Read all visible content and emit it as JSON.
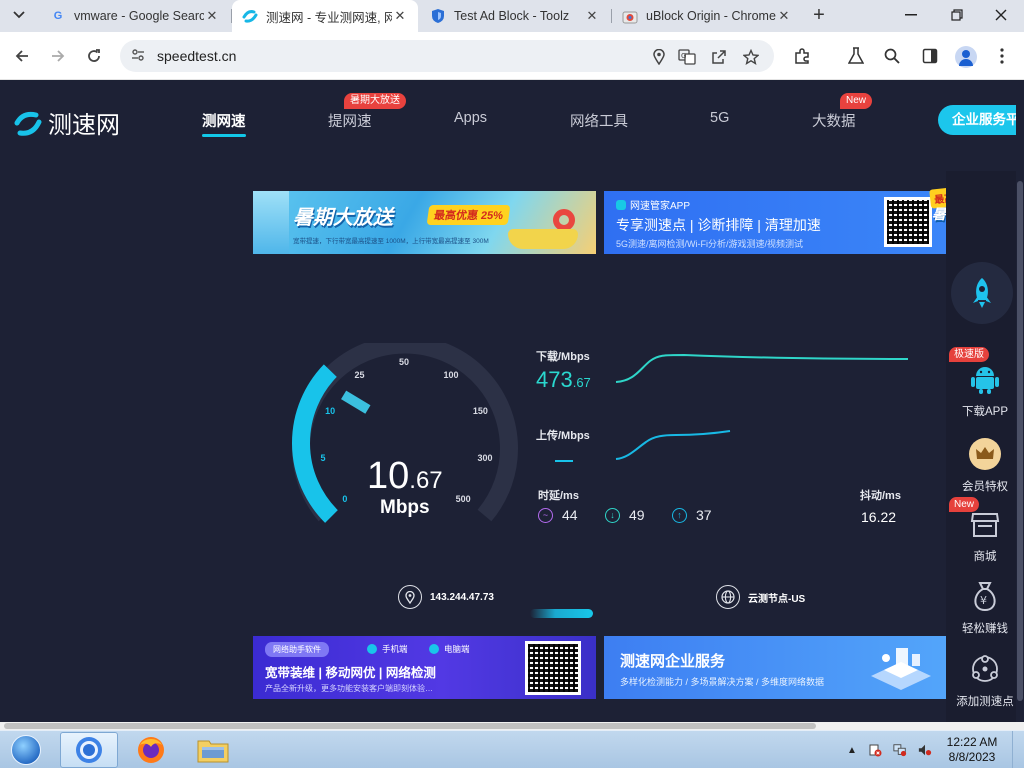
{
  "browser": {
    "tabs": [
      {
        "title": "vmware - Google Searc",
        "favicon": "google-icon"
      },
      {
        "title": "测速网 - 专业测网速, 网",
        "favicon": "speedtest-icon",
        "active": true
      },
      {
        "title": "Test Ad Block - Toolz",
        "favicon": "shield-icon"
      },
      {
        "title": "uBlock Origin - Chrome",
        "favicon": "chrome-web-store-icon"
      }
    ],
    "url": "speedtest.cn"
  },
  "site": {
    "logo_text": "测速网",
    "nav": [
      {
        "label": "测网速",
        "active": true
      },
      {
        "label": "提网速",
        "badge": "暑期大放送"
      },
      {
        "label": "Apps"
      },
      {
        "label": "网络工具"
      },
      {
        "label": "5G"
      },
      {
        "label": "大数据",
        "badge": "New"
      }
    ],
    "enterprise_button": "企业服务平"
  },
  "banners": {
    "summer": {
      "headline": "暑期大放送",
      "pill": "最高优惠 25%",
      "sub": "宽带提速，下行带宽最高提速至 1000M，上行带宽最高提速至 300M"
    },
    "app": {
      "app_name": "网速管家APP",
      "services": "专享测速点 | 诊断排障 | 清理加速",
      "features": "5G测速/离网检测/Wi-Fi分析/游戏测速/视频测试"
    },
    "summer_badge": {
      "pill": "最高优惠 25%",
      "headline": "暑期大放送"
    },
    "tool": {
      "tag": "网络助手软件",
      "platform_mobile": "手机端",
      "platform_pc": "电脑端",
      "services": "宽带装维 | 移动网优 | 网络检测",
      "note": "产品全新升级，更多功能安装客户端即刻体验…"
    },
    "enterprise": {
      "title": "测速网企业服务",
      "capabilities": "多样化检测能力 / 多场景解决方案 / 多维度网络数据"
    }
  },
  "gauge": {
    "ticks": [
      "0",
      "5",
      "10",
      "25",
      "50",
      "100",
      "150",
      "300",
      "500"
    ],
    "value_int": "10",
    "value_dec": ".67",
    "unit": "Mbps",
    "fraction": 0.33
  },
  "metrics": {
    "download_label": "下载/Mbps",
    "download_int": "473",
    "download_dec": ".67",
    "upload_label": "上传/Mbps",
    "latency_label": "时延/ms",
    "latency_values": [
      "44",
      "49",
      "37"
    ],
    "jitter_label": "抖动/ms",
    "jitter_value": "16.22"
  },
  "connection": {
    "ip": "143.244.47.73",
    "node": "云测节点-US"
  },
  "right_rail": {
    "items": [
      {
        "label": "下载APP",
        "badge": "极速版"
      },
      {
        "label": "会员特权"
      },
      {
        "label": "商城",
        "badge": "New"
      },
      {
        "label": "轻松赚钱"
      },
      {
        "label": "添加测速点"
      }
    ]
  },
  "taskbar": {
    "time": "12:22 AM",
    "date": "8/8/2023"
  },
  "colors": {
    "page_bg": "#1d2135",
    "accent_cyan": "#18c3ea",
    "download_teal": "#2ad8cf",
    "badge_red": "#e8423e"
  }
}
